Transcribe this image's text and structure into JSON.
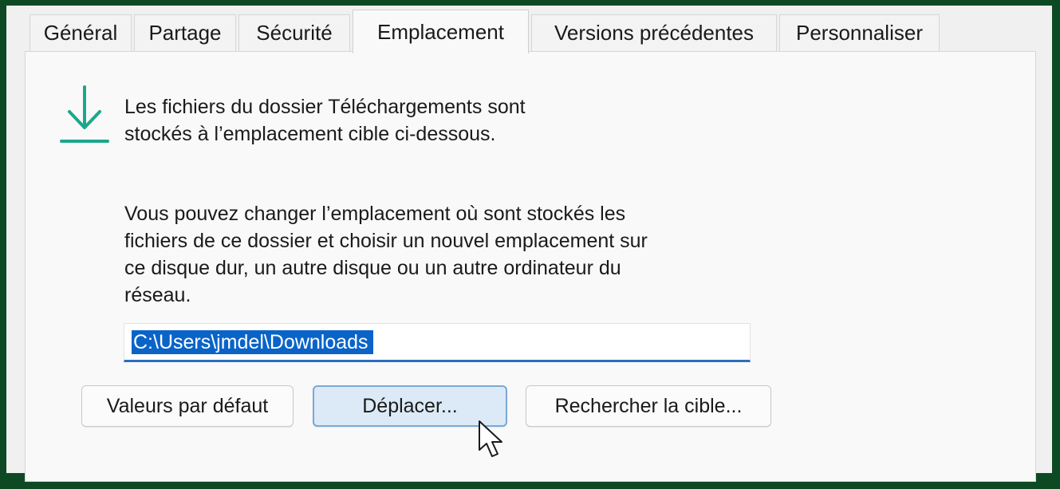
{
  "tabs": [
    {
      "label": "Général",
      "active": false
    },
    {
      "label": "Partage",
      "active": false
    },
    {
      "label": "Sécurité",
      "active": false
    },
    {
      "label": "Emplacement",
      "active": true
    },
    {
      "label": "Versions précédentes",
      "active": false
    },
    {
      "label": "Personnaliser",
      "active": false
    }
  ],
  "content": {
    "icon": "download-arrow-icon",
    "intro_text": "Les fichiers du dossier Téléchargements sont\nstockés à l’emplacement cible ci-dessous.",
    "description": "Vous pouvez changer l’emplacement où sont stockés les\nfichiers de ce dossier et choisir un nouvel emplacement sur\nce disque dur, un autre disque ou un autre ordinateur du\nréseau.",
    "path_value": "C:\\Users\\jmdel\\Downloads"
  },
  "buttons": {
    "default_label": "Valeurs par défaut",
    "move_label": "Déplacer...",
    "find_target_label": "Rechercher la cible..."
  },
  "colors": {
    "accent": "#1aa88a",
    "selection": "#0a64c8",
    "frame": "#0d4a23"
  }
}
